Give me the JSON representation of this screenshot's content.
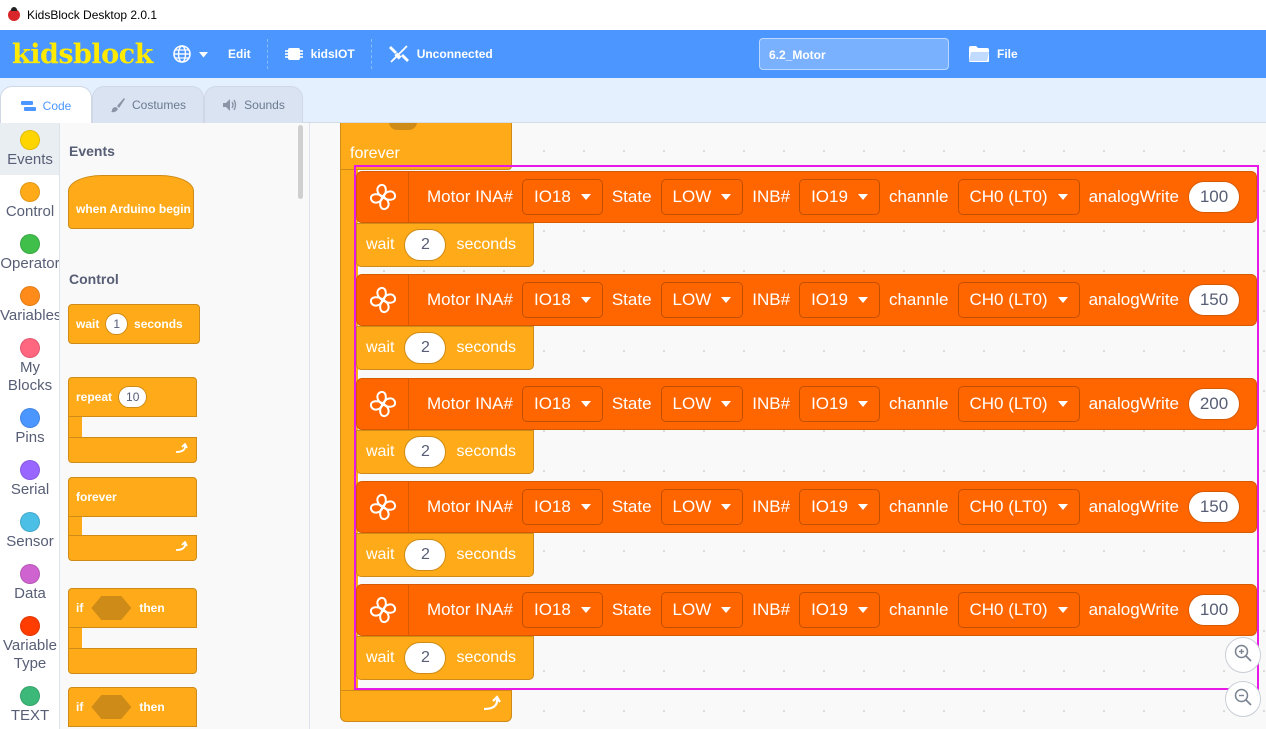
{
  "window": {
    "title": "KidsBlock Desktop 2.0.1"
  },
  "menubar": {
    "logo": "kidsblock",
    "items": [
      {
        "label": "",
        "icon": "globe-icon"
      },
      {
        "label": "Edit"
      },
      {
        "label": "kidsIOT",
        "icon": "chip-icon"
      },
      {
        "label": "Unconnected",
        "icon": "unplugged-icon"
      }
    ],
    "project_title": "6.2_Motor",
    "file_label": "File"
  },
  "tabs": [
    {
      "label": "Code",
      "icon": "code-icon",
      "active": true
    },
    {
      "label": "Costumes",
      "icon": "brush-icon"
    },
    {
      "label": "Sounds",
      "icon": "speaker-icon"
    }
  ],
  "categories": [
    {
      "label": "Events",
      "color": "#ffd500"
    },
    {
      "label": "Control",
      "color": "#ffab19"
    },
    {
      "label": "Operator",
      "color": "#40bf4a"
    },
    {
      "label": "Variables",
      "color": "#ff8c1a"
    },
    {
      "label": "My Blocks",
      "color": "#ff6680"
    },
    {
      "label": "Pins",
      "color": "#4c97ff"
    },
    {
      "label": "Serial",
      "color": "#9966ff"
    },
    {
      "label": "Sensor",
      "color": "#4cbfe6"
    },
    {
      "label": "Data",
      "color": "#cf63cf"
    },
    {
      "label": "Variable Type",
      "color": "#ff3d00"
    },
    {
      "label": "TEXT",
      "color": "#3cb878"
    }
  ],
  "palette": {
    "events_heading": "Events",
    "when_begin": "when Arduino begin",
    "control_heading": "Control",
    "wait_label": "wait",
    "wait_value": "1",
    "wait_unit": "seconds",
    "repeat_label": "repeat",
    "repeat_value": "10",
    "forever_label": "forever",
    "if_label": "if",
    "then_label": "then"
  },
  "script": {
    "forever_label": "forever",
    "motor_labels": {
      "name": "Motor INA#",
      "state": "State",
      "inb": "INB#",
      "channel": "channle",
      "analog": "analogWrite"
    },
    "wait_label": "wait",
    "wait_unit": "seconds",
    "steps": [
      {
        "ina": "IO18",
        "state": "LOW",
        "inb": "IO19",
        "channel": "CH0 (LT0)",
        "value": "100",
        "wait": "2"
      },
      {
        "ina": "IO18",
        "state": "LOW",
        "inb": "IO19",
        "channel": "CH0 (LT0)",
        "value": "150",
        "wait": "2"
      },
      {
        "ina": "IO18",
        "state": "LOW",
        "inb": "IO19",
        "channel": "CH0 (LT0)",
        "value": "200",
        "wait": "2"
      },
      {
        "ina": "IO18",
        "state": "LOW",
        "inb": "IO19",
        "channel": "CH0 (LT0)",
        "value": "150",
        "wait": "2"
      },
      {
        "ina": "IO18",
        "state": "LOW",
        "inb": "IO19",
        "channel": "CH0 (LT0)",
        "value": "100",
        "wait": "2"
      }
    ]
  },
  "colors": {
    "menubar": "#4c97ff",
    "logo": "#ffea00",
    "control_block": "#ffab19",
    "motor_block": "#ff6600",
    "highlight": "#e619e6"
  }
}
